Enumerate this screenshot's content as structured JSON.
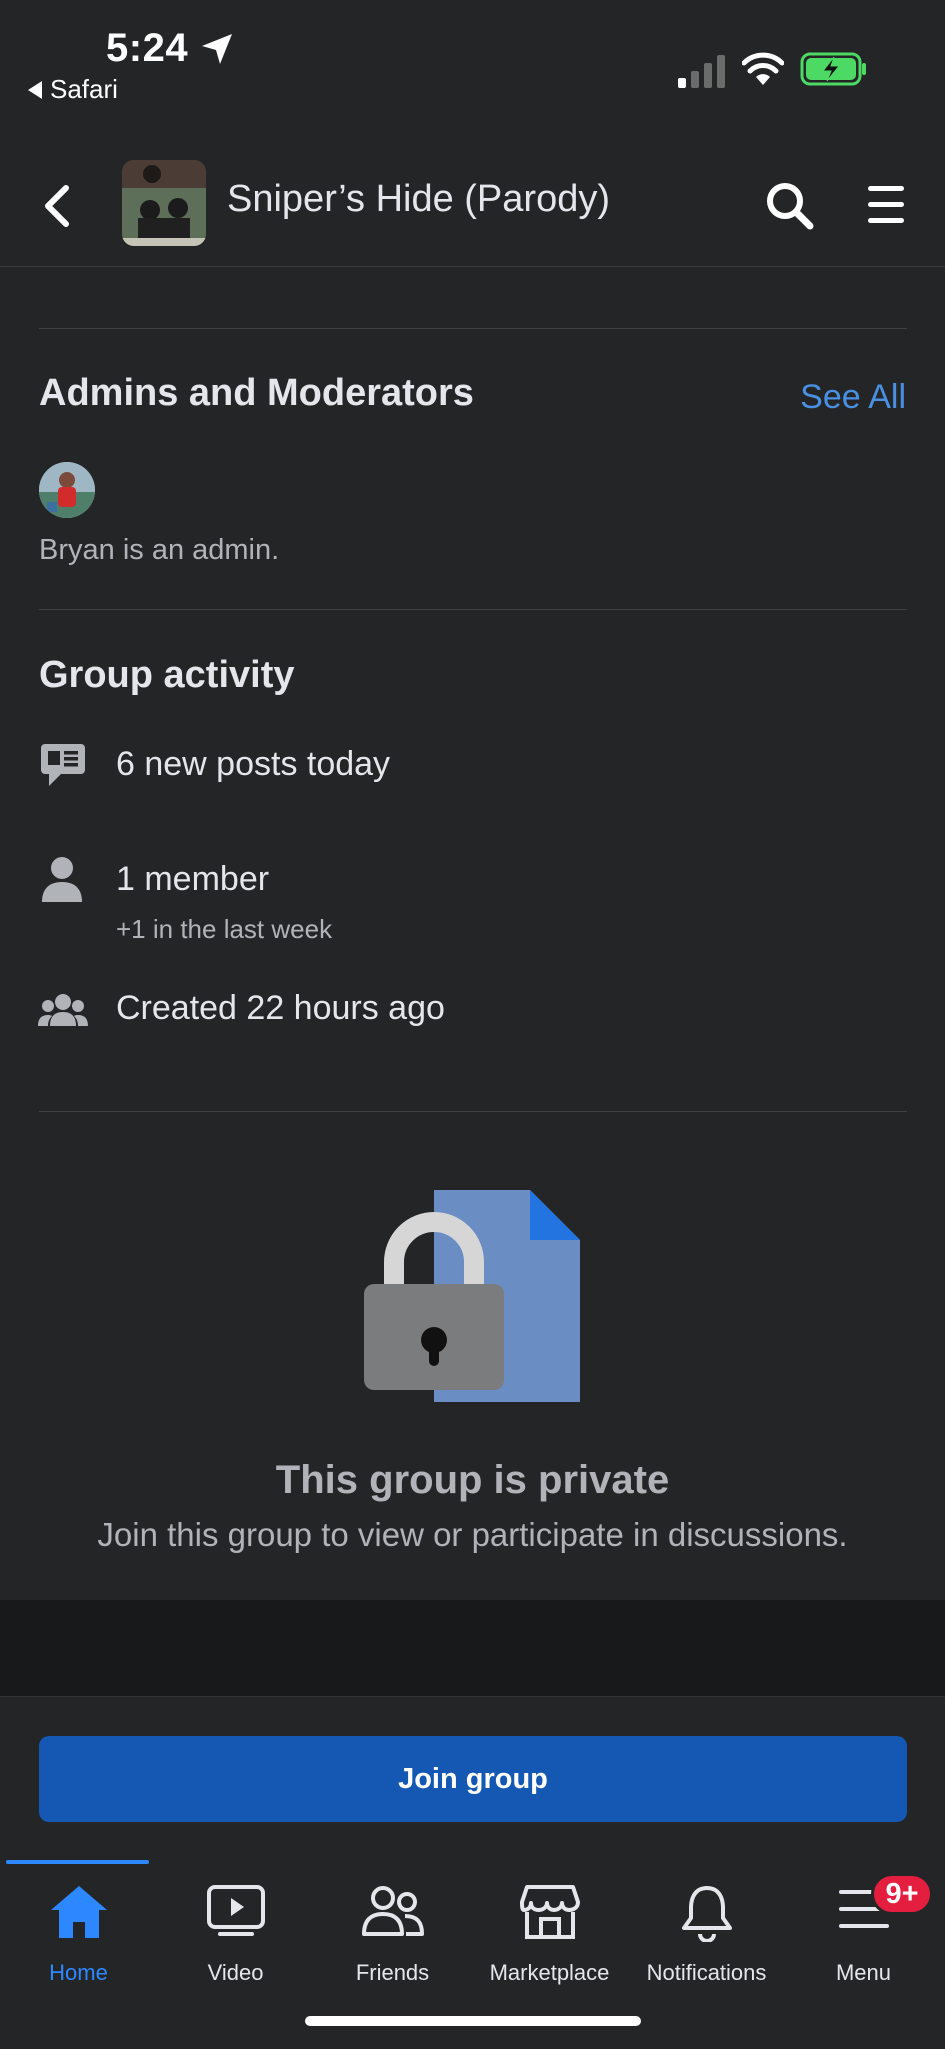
{
  "status_bar": {
    "time": "5:24",
    "back_app": "Safari"
  },
  "header": {
    "title": "Sniper’s Hide (Parody)"
  },
  "admins": {
    "title": "Admins and Moderators",
    "see_all": "See All",
    "caption": "Bryan is an admin."
  },
  "activity": {
    "title": "Group activity",
    "posts": "6 new posts today",
    "members": "1 member",
    "members_sub": "+1 in the last week",
    "created": "Created 22 hours ago"
  },
  "private": {
    "title": "This group is private",
    "subtitle": "Join this group to view or participate in discussions."
  },
  "join_button": "Join group",
  "tabs": [
    {
      "label": "Home",
      "icon": "home-icon",
      "active": true
    },
    {
      "label": "Video",
      "icon": "video-icon"
    },
    {
      "label": "Friends",
      "icon": "friends-icon"
    },
    {
      "label": "Marketplace",
      "icon": "marketplace-icon"
    },
    {
      "label": "Notifications",
      "icon": "bell-icon"
    },
    {
      "label": "Menu",
      "icon": "menu-icon",
      "badge": "9+"
    }
  ],
  "colors": {
    "background": "#242526",
    "accent": "#2d88ff",
    "join_button": "#1458b3",
    "badge": "#e41e3f"
  }
}
